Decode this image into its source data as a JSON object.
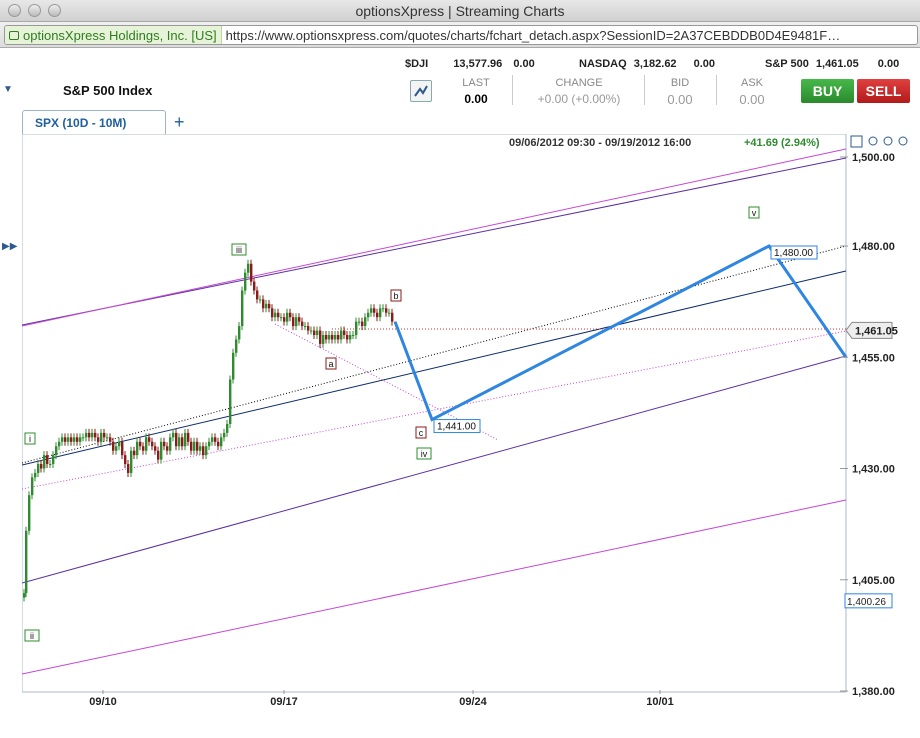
{
  "window": {
    "title": "optionsXpress | Streaming Charts"
  },
  "urlbar": {
    "site": "optionsXpress Holdings, Inc. [US]",
    "url": "https://www.optionsxpress.com/quotes/charts/fchart_detach.aspx?SessionID=2A37CEBDDB0D4E9481F…"
  },
  "tickers": [
    {
      "sym": "$DJI",
      "price": "13,577.96",
      "chg": "0.00"
    },
    {
      "sym": "NASDAQ",
      "price": "3,182.62",
      "chg": "0.00"
    },
    {
      "sym": "S&P 500",
      "price": "1,461.05",
      "chg": "0.00"
    }
  ],
  "quote": {
    "name": "S&P 500 Index",
    "last_label": "LAST",
    "last": "0.00",
    "change_label": "CHANGE",
    "change": "+0.00 (+0.00%)",
    "bid_label": "BID",
    "bid": "0.00",
    "ask_label": "ASK",
    "ask": "0.00",
    "buy": "BUY",
    "sell": "SELL"
  },
  "tab": {
    "label": "SPX (10D - 10M)",
    "add": "+"
  },
  "chart_header": {
    "range": "09/06/2012 09:30 - 09/19/2012 16:00",
    "change": "+41.69 (2.94%)"
  },
  "colors": {
    "price_up": "#2e8b2e",
    "price_down": "#8b1a1a",
    "projection": "#2f86e0",
    "purple": "#5b2ea0",
    "magenta": "#c646d4",
    "navy": "#0b2a6b"
  },
  "chart_data": {
    "type": "line",
    "title": "",
    "ylim": [
      1380,
      1500
    ],
    "y_ticks": [
      "1,500.00",
      "1,480.00",
      "1,455.00",
      "1,430.00",
      "1,405.00",
      "1,380.00"
    ],
    "x_ticks": [
      "09/10",
      "09/17",
      "09/24",
      "10/01"
    ],
    "price_labels": {
      "current": "1,461.05",
      "low": "1,400.26"
    },
    "projection": {
      "points": [
        1463,
        1441,
        1480,
        1455
      ],
      "labels": [
        "1,441.00",
        "1,480.00"
      ]
    },
    "wave_labels": [
      "i",
      "ii",
      "iii",
      "a",
      "b",
      "c",
      "iv",
      "v"
    ]
  },
  "icons": {
    "window_controls": "traffic-light-icons",
    "chart_tools": [
      "square-icon",
      "zoom-in-icon",
      "zoom-out-icon",
      "zoom-reset-icon",
      "zoom-icon",
      "settings-icon"
    ]
  }
}
